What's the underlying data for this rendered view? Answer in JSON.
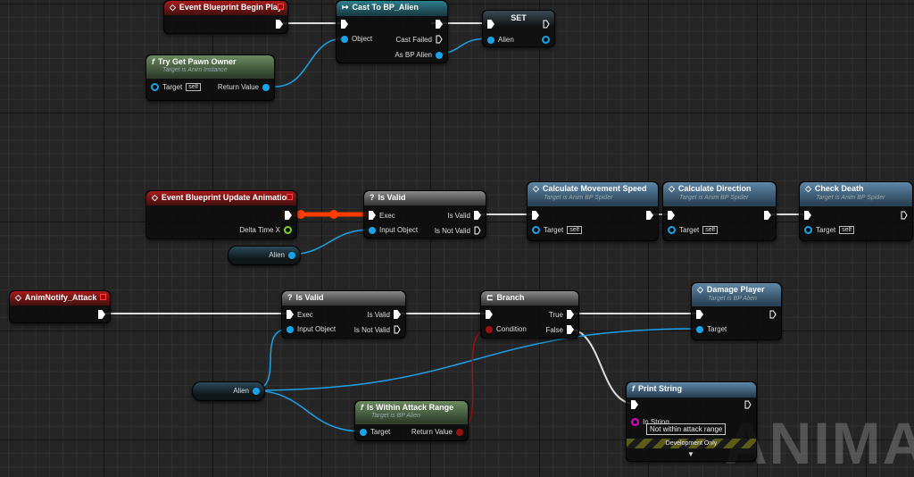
{
  "watermark": "ANIMATI",
  "colors": {
    "exec": "#ffffff",
    "object_pin": "#1ba3ea",
    "bool_pin": "#9b1010",
    "float_pin": "#7ed321",
    "string_pin": "#e400c8",
    "active_exec_wire": "#ff3c00"
  },
  "nodes": {
    "begin_play": {
      "title": "Event Blueprint Begin Play",
      "icon": "event-diamond-icon"
    },
    "cast": {
      "title": "Cast To BP_Alien",
      "object": "Object",
      "cast_failed": "Cast Failed",
      "as_alien": "As BP Alien"
    },
    "set": {
      "title": "SET",
      "alien": "Alien"
    },
    "try_get_pawn": {
      "title": "Try Get Pawn Owner",
      "subtitle": "Target is Anim Instance",
      "target": "Target",
      "self": "self",
      "return_value": "Return Value"
    },
    "update_anim": {
      "title": "Event Blueprint Update Animation",
      "delta": "Delta Time X"
    },
    "is_valid_1": {
      "title": "Is Valid",
      "exec": "Exec",
      "input": "Input Object",
      "is_valid": "Is Valid",
      "not_valid": "Is Not Valid"
    },
    "alien_getter_1": {
      "label": "Alien"
    },
    "calc_speed": {
      "title": "Calculate Movement Speed",
      "subtitle": "Target is Anim BP Spider",
      "target": "Target",
      "self": "self"
    },
    "calc_dir": {
      "title": "Calculate Direction",
      "subtitle": "Target is Anim BP Spider",
      "target": "Target",
      "self": "self"
    },
    "check_death": {
      "title": "Check Death",
      "subtitle": "Target is Anim BP Spider",
      "target": "Target",
      "self": "self"
    },
    "anim_notify": {
      "title": "AnimNotify_Attack"
    },
    "is_valid_2": {
      "title": "Is Valid",
      "exec": "Exec",
      "input": "Input Object",
      "is_valid": "Is Valid",
      "not_valid": "Is Not Valid"
    },
    "branch": {
      "title": "Branch",
      "condition": "Condition",
      "true": "True",
      "false": "False"
    },
    "damage_player": {
      "title": "Damage Player",
      "subtitle": "Target is BP Alien",
      "target": "Target"
    },
    "alien_getter_2": {
      "label": "Alien"
    },
    "within_range": {
      "title": "Is Within Attack Range",
      "subtitle": "Target is BP Alien",
      "target": "Target",
      "return_value": "Return Value"
    },
    "print_string": {
      "title": "Print String",
      "in_string": "In String",
      "value": "Not within attack range",
      "dev": "Development Only"
    }
  }
}
